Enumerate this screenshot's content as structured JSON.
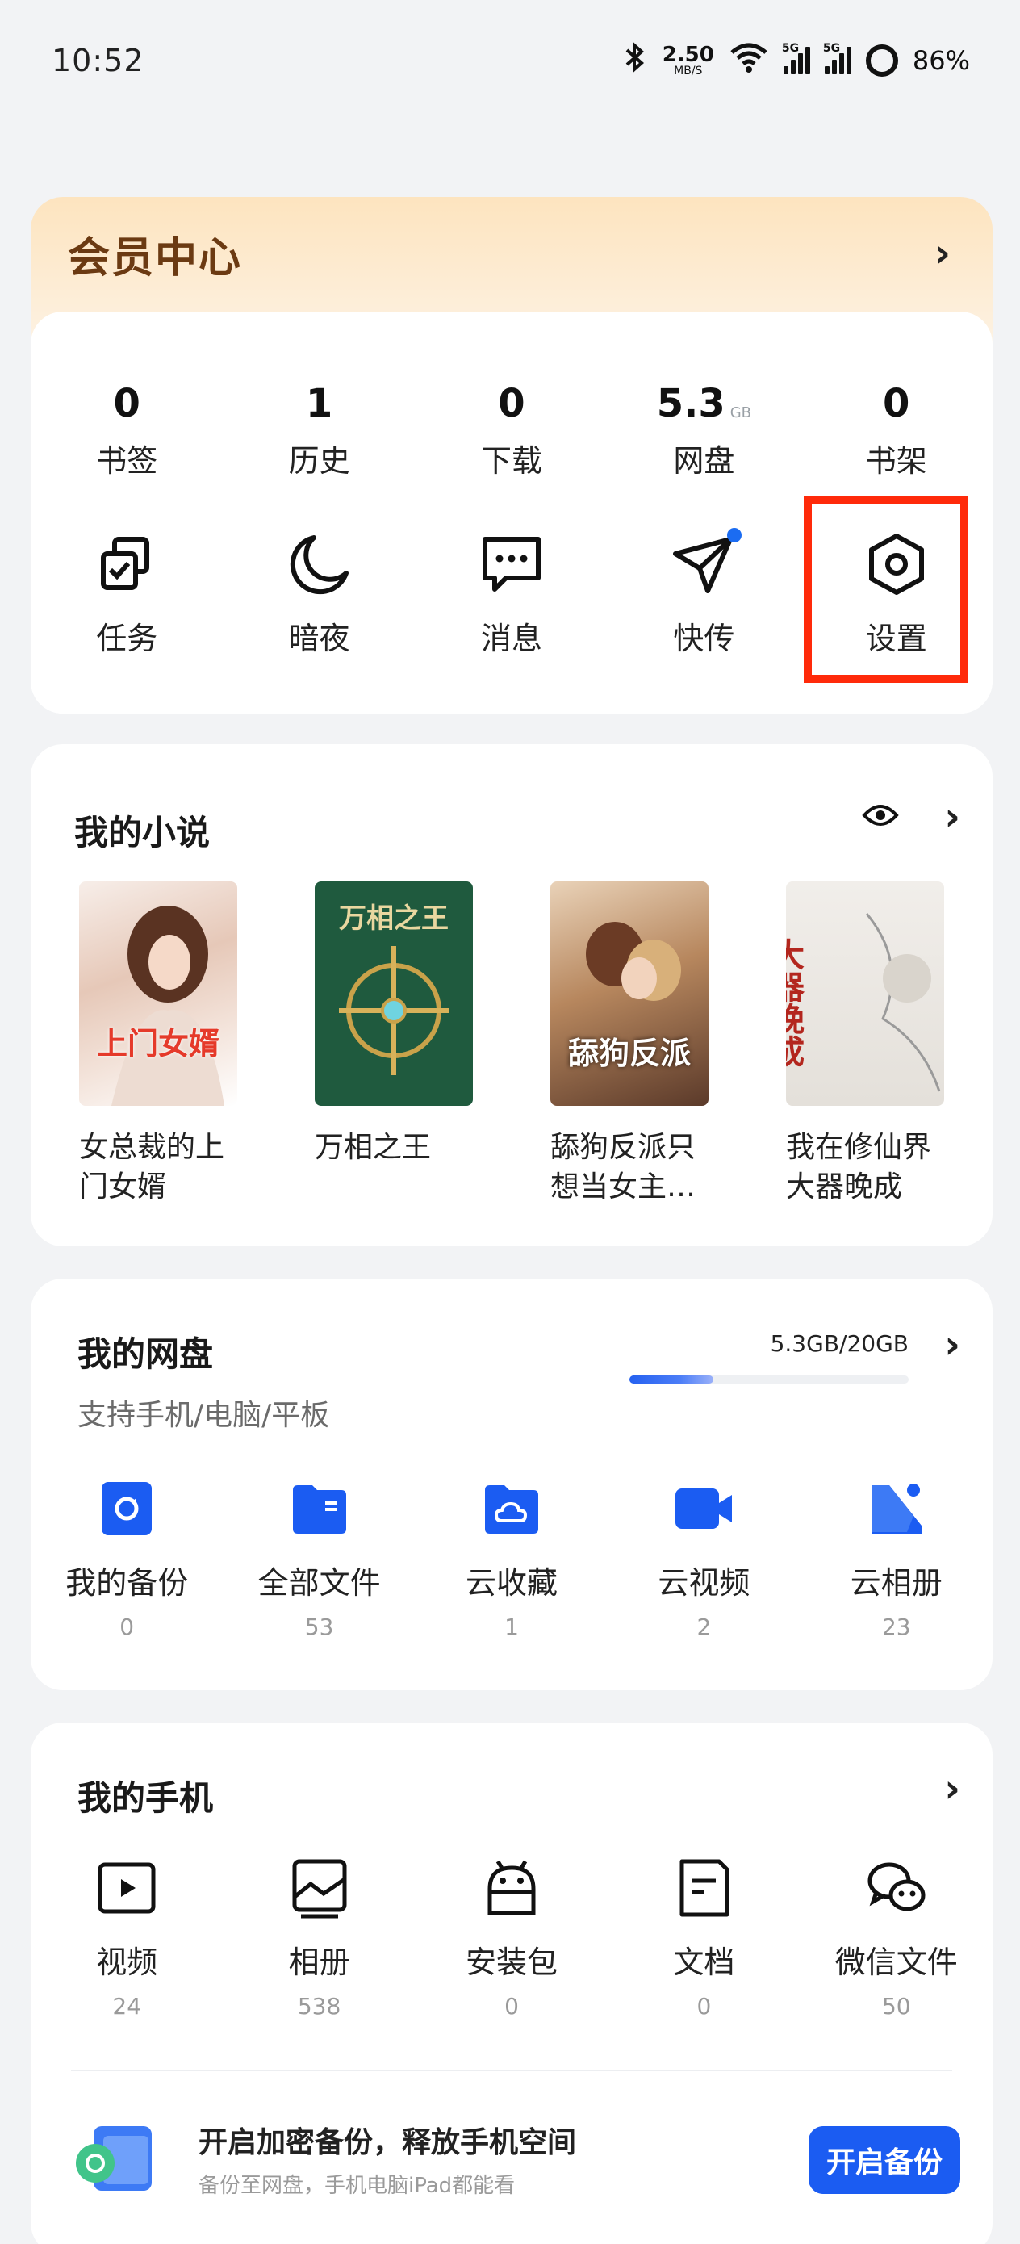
{
  "status_bar": {
    "time": "10:52",
    "speed_value": "2.50",
    "speed_unit": "MB/S",
    "sim1": "5G",
    "sim2": "5G",
    "battery": "86%"
  },
  "member": {
    "title": "会员中心",
    "stats": [
      {
        "value": "0",
        "unit": "",
        "label": "书签"
      },
      {
        "value": "1",
        "unit": "",
        "label": "历史"
      },
      {
        "value": "0",
        "unit": "",
        "label": "下载"
      },
      {
        "value": "5.3",
        "unit": "GB",
        "label": "网盘"
      },
      {
        "value": "0",
        "unit": "",
        "label": "书架"
      }
    ],
    "tools": [
      {
        "label": "任务",
        "icon": "task-icon"
      },
      {
        "label": "暗夜",
        "icon": "moon-icon"
      },
      {
        "label": "消息",
        "icon": "message-icon"
      },
      {
        "label": "快传",
        "icon": "send-icon"
      },
      {
        "label": "设置",
        "icon": "settings-icon"
      }
    ]
  },
  "novels": {
    "title": "我的小说",
    "books": [
      {
        "title": "女总裁的上门女婿",
        "cover_text": "上门女婿"
      },
      {
        "title": "万相之王",
        "cover_text": "万相之王"
      },
      {
        "title": "舔狗反派只想当女主…",
        "cover_text": "舔狗反派"
      },
      {
        "title": "我在修仙界大器晚成",
        "cover_text": "大器晚成"
      }
    ]
  },
  "drive": {
    "title": "我的网盘",
    "subtitle": "支持手机/电脑/平板",
    "usage_text": "5.3GB/20GB",
    "usage_fraction": 0.3,
    "items": [
      {
        "label": "我的备份",
        "count": "0",
        "icon": "backup-icon"
      },
      {
        "label": "全部文件",
        "count": "53",
        "icon": "folder-icon"
      },
      {
        "label": "云收藏",
        "count": "1",
        "icon": "cloud-folder-icon"
      },
      {
        "label": "云视频",
        "count": "2",
        "icon": "video-camera-icon"
      },
      {
        "label": "云相册",
        "count": "23",
        "icon": "photo-icon"
      }
    ]
  },
  "phone": {
    "title": "我的手机",
    "items": [
      {
        "label": "视频",
        "count": "24",
        "icon": "play-icon"
      },
      {
        "label": "相册",
        "count": "538",
        "icon": "album-icon"
      },
      {
        "label": "安装包",
        "count": "0",
        "icon": "android-icon"
      },
      {
        "label": "文档",
        "count": "0",
        "icon": "document-icon"
      },
      {
        "label": "微信文件",
        "count": "50",
        "icon": "wechat-icon"
      }
    ],
    "promo_title": "开启加密备份，释放手机空间",
    "promo_subtitle": "备份至网盘，手机电脑iPad都能看",
    "promo_button": "开启备份"
  },
  "colors": {
    "accent": "#1b5cf2",
    "highlight": "#ff2a0a",
    "member_title": "#6b3a12"
  }
}
